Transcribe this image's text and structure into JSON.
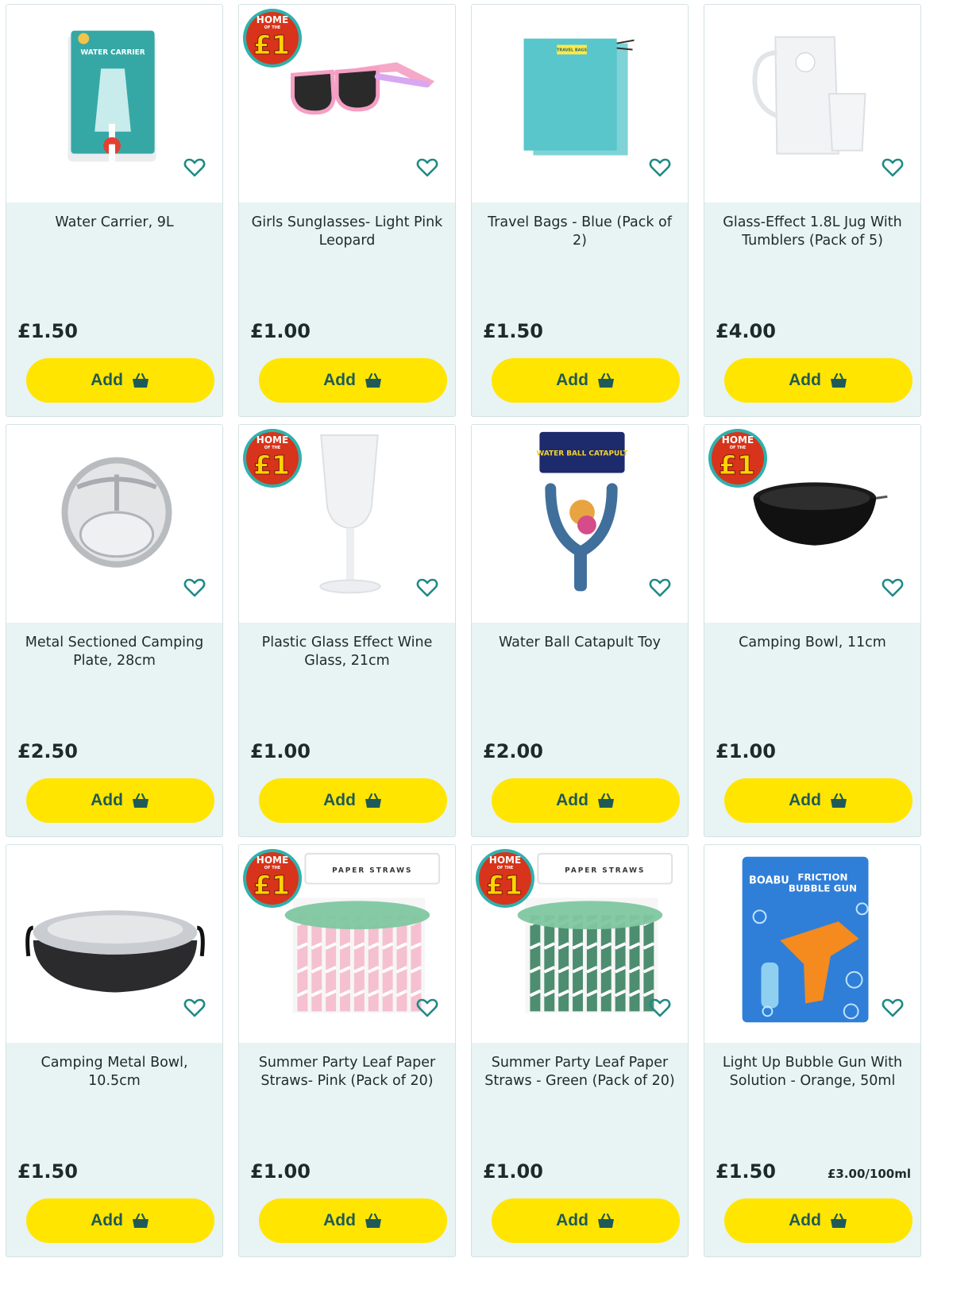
{
  "products": [
    {
      "title": "Water Carrier, 9L",
      "price": "£1.50",
      "unit_price": "",
      "badge": false,
      "image": "water-carrier"
    },
    {
      "title": "Girls Sunglasses- Light Pink Leopard",
      "price": "£1.00",
      "unit_price": "",
      "badge": true,
      "image": "sunglasses"
    },
    {
      "title": "Travel Bags - Blue (Pack of 2)",
      "price": "£1.50",
      "unit_price": "",
      "badge": false,
      "image": "travel-bags"
    },
    {
      "title": "Glass-Effect 1.8L Jug With Tumblers (Pack of 5)",
      "price": "£4.00",
      "unit_price": "",
      "badge": false,
      "image": "jug-tumblers"
    },
    {
      "title": "Metal Sectioned Camping Plate, 28cm",
      "price": "£2.50",
      "unit_price": "",
      "badge": false,
      "image": "camping-plate"
    },
    {
      "title": "Plastic Glass Effect Wine Glass, 21cm",
      "price": "£1.00",
      "unit_price": "",
      "badge": true,
      "image": "wine-glass"
    },
    {
      "title": "Water Ball Catapult Toy",
      "price": "£2.00",
      "unit_price": "",
      "badge": false,
      "image": "catapult"
    },
    {
      "title": "Camping Bowl, 11cm",
      "price": "£1.00",
      "unit_price": "",
      "badge": true,
      "image": "black-bowl"
    },
    {
      "title": "Camping Metal Bowl, 10.5cm",
      "price": "£1.50",
      "unit_price": "",
      "badge": false,
      "image": "metal-bowl"
    },
    {
      "title": "Summer Party Leaf Paper Straws- Pink (Pack of 20)",
      "price": "£1.00",
      "unit_price": "",
      "badge": true,
      "image": "straws-pink"
    },
    {
      "title": "Summer Party Leaf Paper Straws - Green (Pack of 20)",
      "price": "£1.00",
      "unit_price": "",
      "badge": true,
      "image": "straws-green"
    },
    {
      "title": "Light Up Bubble Gun With Solution - Orange, 50ml",
      "price": "£1.50",
      "unit_price": "£3.00/100ml",
      "badge": false,
      "image": "bubble-gun"
    }
  ],
  "labels": {
    "add": "Add",
    "badge_top": "HOME",
    "badge_mid": "OF THE",
    "badge_main": "£1",
    "package_water_carrier": "WATER CARRIER",
    "package_travel_bags": "TRAVEL BAGS",
    "package_catapult": "WATER BALL CATAPULT",
    "package_straws": "PAPER STRAWS",
    "package_bubble_brand": "BOABU",
    "package_bubble_title_1": "FRICTION",
    "package_bubble_title_2": "BUBBLE GUN"
  },
  "colors": {
    "card_bg": "#e8f3f4",
    "button": "#ffe500",
    "button_text": "#1f5a56",
    "badge_red": "#d7341b",
    "badge_yellow": "#ffd400",
    "heart": "#1f8a86"
  }
}
